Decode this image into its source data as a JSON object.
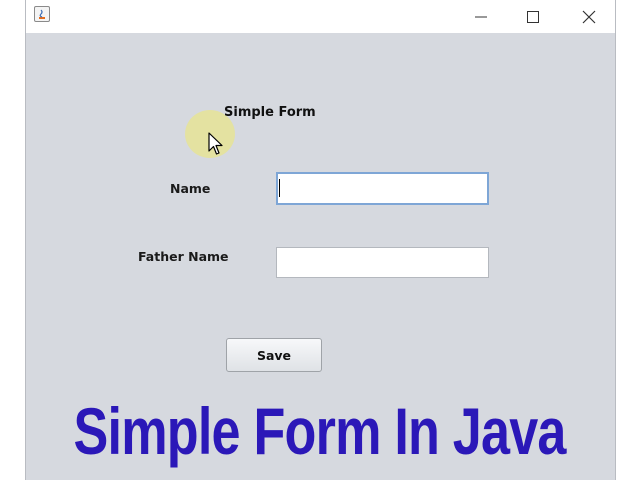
{
  "window": {
    "title_icon": "java-icon",
    "controls": [
      "minimize-icon",
      "maximize-icon",
      "close-icon"
    ]
  },
  "form": {
    "title": "Simple Form",
    "name_label": "Name",
    "name_value": "",
    "father_name_label": "Father Name",
    "father_name_value": "",
    "save_label": "Save"
  },
  "banner": {
    "text": "Simple Form In Java",
    "color": "#2b18b8"
  },
  "colors": {
    "window_background": "#d6d9df",
    "focus_border": "#7ea6d6"
  }
}
